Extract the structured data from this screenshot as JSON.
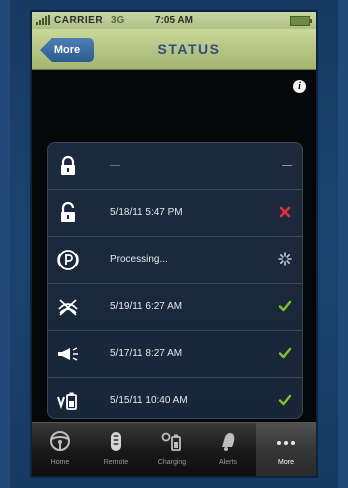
{
  "status_bar": {
    "carrier": "CARRIER",
    "network": "3G",
    "time": "7:05 AM"
  },
  "nav": {
    "back_label": "More",
    "title": "STATUS",
    "info_icon": "info-icon"
  },
  "status_rows": [
    {
      "icon": "lock-closed-icon",
      "text": "—",
      "state": "—"
    },
    {
      "icon": "lock-open-icon",
      "text": "5/18/11 5:47 PM",
      "state": "error-x-icon"
    },
    {
      "icon": "parking-brake-icon",
      "text": "Processing...",
      "state": "spinner-icon"
    },
    {
      "icon": "climate-off-icon",
      "text": "5/19/11 6:27 AM",
      "state": "checkmark-icon"
    },
    {
      "icon": "horn-lights-icon",
      "text": "5/17/11 8:27 AM",
      "state": "checkmark-icon"
    },
    {
      "icon": "charge-battery-icon",
      "text": "5/15/11 10:40 AM",
      "state": "checkmark-icon"
    }
  ],
  "tabs": [
    {
      "label": "Home",
      "icon": "steering-wheel-icon"
    },
    {
      "label": "Remote",
      "icon": "key-fob-icon"
    },
    {
      "label": "Charging",
      "icon": "plug-battery-icon"
    },
    {
      "label": "Alerts",
      "icon": "bell-icon"
    },
    {
      "label": "More",
      "icon": "ellipsis-icon",
      "active": true
    }
  ],
  "colors": {
    "check": "#7fc22a",
    "error": "#e0303a",
    "nav_title": "#2f4f80",
    "back_button": "#2a5a90"
  }
}
